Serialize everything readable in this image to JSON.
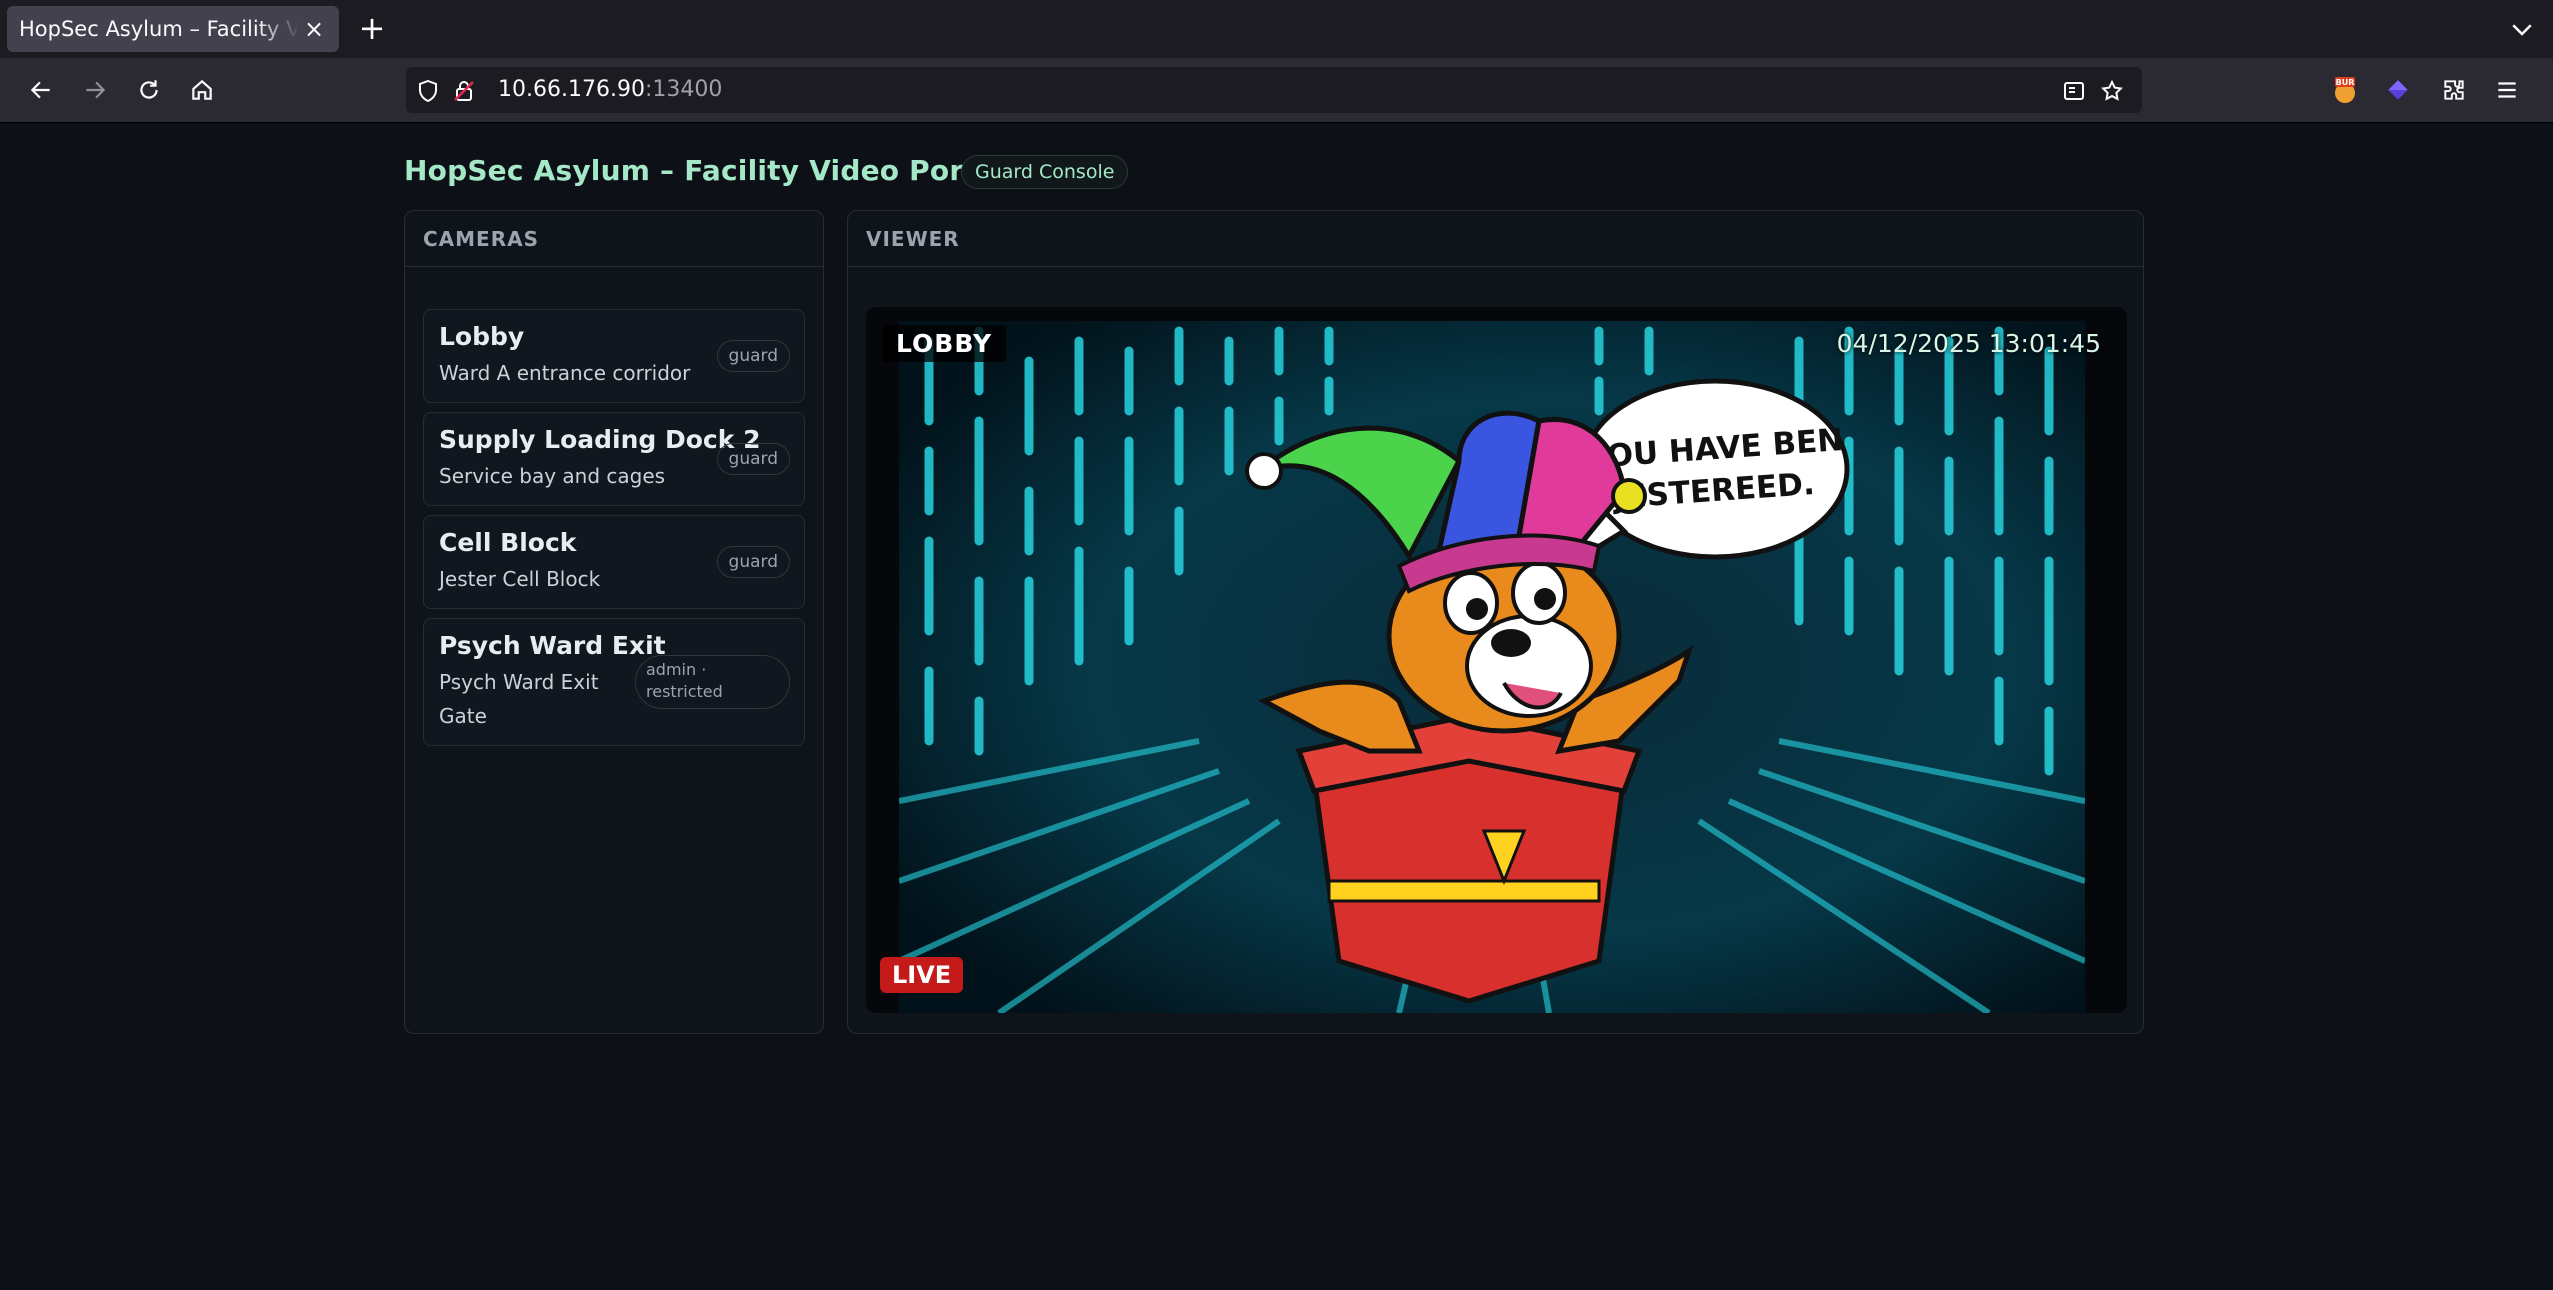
{
  "browser": {
    "tab_title": "HopSec Asylum – Facility Video Portal",
    "url_host": "10.66.176.90",
    "url_port": ":13400"
  },
  "page": {
    "title": "HopSec Asylum – Facility Video Portal",
    "role_badge": "Guard Console"
  },
  "cameras_panel": {
    "heading": "CAMERAS",
    "items": [
      {
        "name": "Lobby",
        "description": "Ward A entrance corridor",
        "access": "guard"
      },
      {
        "name": "Supply Loading Dock 2",
        "description": "Service bay and cages",
        "access": "guard"
      },
      {
        "name": "Cell Block",
        "description": "Jester Cell Block",
        "access": "guard"
      },
      {
        "name": "Psych Ward Exit",
        "description": "Psych Ward Exit Gate",
        "access": "admin · restricted"
      }
    ]
  },
  "viewer_panel": {
    "heading": "VIEWER",
    "camera_label": "LOBBY",
    "timestamp": "04/12/2025 13:01:45",
    "live_label": "LIVE",
    "speech_text": "YOU HAVE BEN JESTEREED."
  },
  "colors": {
    "accent": "#a5e8c8",
    "live": "#c41a1a",
    "background": "#0d1117"
  }
}
